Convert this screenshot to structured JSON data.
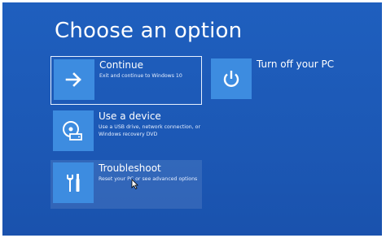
{
  "screen": {
    "title": "Choose an option"
  },
  "options": {
    "continue": {
      "label": "Continue",
      "description": "Exit and continue to Windows 10",
      "icon": "arrow-right-icon"
    },
    "turn_off": {
      "label": "Turn off your PC",
      "icon": "power-icon"
    },
    "use_device": {
      "label": "Use a device",
      "description": "Use a USB drive, network connection, or Windows recovery DVD",
      "icon": "disc-drive-icon"
    },
    "troubleshoot": {
      "label": "Troubleshoot",
      "description": "Reset your PC or see advanced options",
      "icon": "tools-icon"
    }
  },
  "colors": {
    "background": "#1c58b5",
    "tile": "#3d8ce0",
    "text": "#ffffff"
  }
}
